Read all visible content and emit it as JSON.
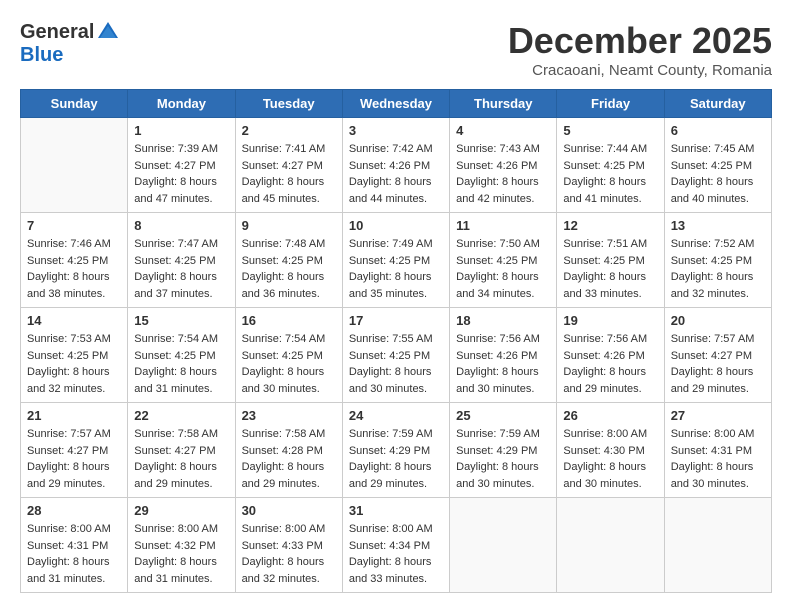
{
  "logo": {
    "general": "General",
    "blue": "Blue"
  },
  "header": {
    "month": "December 2025",
    "location": "Cracaoani, Neamt County, Romania"
  },
  "days_of_week": [
    "Sunday",
    "Monday",
    "Tuesday",
    "Wednesday",
    "Thursday",
    "Friday",
    "Saturday"
  ],
  "weeks": [
    [
      {
        "day": "",
        "info": ""
      },
      {
        "day": "1",
        "info": "Sunrise: 7:39 AM\nSunset: 4:27 PM\nDaylight: 8 hours\nand 47 minutes."
      },
      {
        "day": "2",
        "info": "Sunrise: 7:41 AM\nSunset: 4:27 PM\nDaylight: 8 hours\nand 45 minutes."
      },
      {
        "day": "3",
        "info": "Sunrise: 7:42 AM\nSunset: 4:26 PM\nDaylight: 8 hours\nand 44 minutes."
      },
      {
        "day": "4",
        "info": "Sunrise: 7:43 AM\nSunset: 4:26 PM\nDaylight: 8 hours\nand 42 minutes."
      },
      {
        "day": "5",
        "info": "Sunrise: 7:44 AM\nSunset: 4:25 PM\nDaylight: 8 hours\nand 41 minutes."
      },
      {
        "day": "6",
        "info": "Sunrise: 7:45 AM\nSunset: 4:25 PM\nDaylight: 8 hours\nand 40 minutes."
      }
    ],
    [
      {
        "day": "7",
        "info": "Sunrise: 7:46 AM\nSunset: 4:25 PM\nDaylight: 8 hours\nand 38 minutes."
      },
      {
        "day": "8",
        "info": "Sunrise: 7:47 AM\nSunset: 4:25 PM\nDaylight: 8 hours\nand 37 minutes."
      },
      {
        "day": "9",
        "info": "Sunrise: 7:48 AM\nSunset: 4:25 PM\nDaylight: 8 hours\nand 36 minutes."
      },
      {
        "day": "10",
        "info": "Sunrise: 7:49 AM\nSunset: 4:25 PM\nDaylight: 8 hours\nand 35 minutes."
      },
      {
        "day": "11",
        "info": "Sunrise: 7:50 AM\nSunset: 4:25 PM\nDaylight: 8 hours\nand 34 minutes."
      },
      {
        "day": "12",
        "info": "Sunrise: 7:51 AM\nSunset: 4:25 PM\nDaylight: 8 hours\nand 33 minutes."
      },
      {
        "day": "13",
        "info": "Sunrise: 7:52 AM\nSunset: 4:25 PM\nDaylight: 8 hours\nand 32 minutes."
      }
    ],
    [
      {
        "day": "14",
        "info": "Sunrise: 7:53 AM\nSunset: 4:25 PM\nDaylight: 8 hours\nand 32 minutes."
      },
      {
        "day": "15",
        "info": "Sunrise: 7:54 AM\nSunset: 4:25 PM\nDaylight: 8 hours\nand 31 minutes."
      },
      {
        "day": "16",
        "info": "Sunrise: 7:54 AM\nSunset: 4:25 PM\nDaylight: 8 hours\nand 30 minutes."
      },
      {
        "day": "17",
        "info": "Sunrise: 7:55 AM\nSunset: 4:25 PM\nDaylight: 8 hours\nand 30 minutes."
      },
      {
        "day": "18",
        "info": "Sunrise: 7:56 AM\nSunset: 4:26 PM\nDaylight: 8 hours\nand 30 minutes."
      },
      {
        "day": "19",
        "info": "Sunrise: 7:56 AM\nSunset: 4:26 PM\nDaylight: 8 hours\nand 29 minutes."
      },
      {
        "day": "20",
        "info": "Sunrise: 7:57 AM\nSunset: 4:27 PM\nDaylight: 8 hours\nand 29 minutes."
      }
    ],
    [
      {
        "day": "21",
        "info": "Sunrise: 7:57 AM\nSunset: 4:27 PM\nDaylight: 8 hours\nand 29 minutes."
      },
      {
        "day": "22",
        "info": "Sunrise: 7:58 AM\nSunset: 4:27 PM\nDaylight: 8 hours\nand 29 minutes."
      },
      {
        "day": "23",
        "info": "Sunrise: 7:58 AM\nSunset: 4:28 PM\nDaylight: 8 hours\nand 29 minutes."
      },
      {
        "day": "24",
        "info": "Sunrise: 7:59 AM\nSunset: 4:29 PM\nDaylight: 8 hours\nand 29 minutes."
      },
      {
        "day": "25",
        "info": "Sunrise: 7:59 AM\nSunset: 4:29 PM\nDaylight: 8 hours\nand 30 minutes."
      },
      {
        "day": "26",
        "info": "Sunrise: 8:00 AM\nSunset: 4:30 PM\nDaylight: 8 hours\nand 30 minutes."
      },
      {
        "day": "27",
        "info": "Sunrise: 8:00 AM\nSunset: 4:31 PM\nDaylight: 8 hours\nand 30 minutes."
      }
    ],
    [
      {
        "day": "28",
        "info": "Sunrise: 8:00 AM\nSunset: 4:31 PM\nDaylight: 8 hours\nand 31 minutes."
      },
      {
        "day": "29",
        "info": "Sunrise: 8:00 AM\nSunset: 4:32 PM\nDaylight: 8 hours\nand 31 minutes."
      },
      {
        "day": "30",
        "info": "Sunrise: 8:00 AM\nSunset: 4:33 PM\nDaylight: 8 hours\nand 32 minutes."
      },
      {
        "day": "31",
        "info": "Sunrise: 8:00 AM\nSunset: 4:34 PM\nDaylight: 8 hours\nand 33 minutes."
      },
      {
        "day": "",
        "info": ""
      },
      {
        "day": "",
        "info": ""
      },
      {
        "day": "",
        "info": ""
      }
    ]
  ]
}
